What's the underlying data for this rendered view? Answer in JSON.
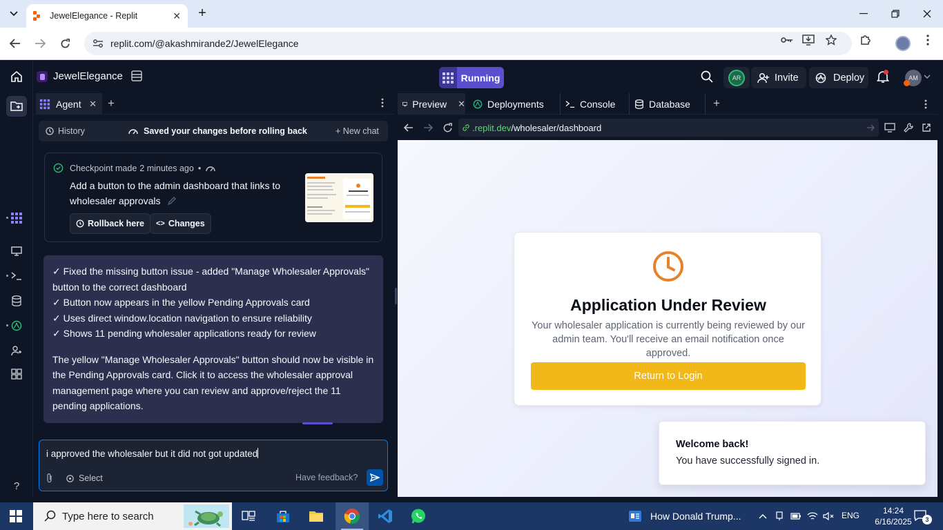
{
  "browser": {
    "tab_title": "JewelElegance - Replit",
    "url": "replit.com/@akashmirande2/JewelElegance"
  },
  "replit": {
    "project_name": "JewelElegance",
    "run_label": "Running",
    "collaborator_initials": "AR",
    "invite_label": "Invite",
    "deploy_label": "Deploy",
    "user_initials": "AM"
  },
  "agent": {
    "tab_label": "Agent",
    "history_label": "History",
    "status_text": "Saved your changes before rolling back",
    "new_chat_label": "New chat",
    "checkpoint": {
      "meta_prefix": "Checkpoint made",
      "meta_time": "2 minutes ago",
      "meta_bullet": "•",
      "message": "Add a button to the admin dashboard that links to wholesaler approvals",
      "rollback_label": "Rollback here",
      "changes_label": "Changes"
    },
    "response": {
      "bullets": [
        "✓ Fixed the missing button issue - added \"Manage Wholesaler Approvals\" button to the correct dashboard",
        "✓ Button now appears in the yellow Pending Approvals card",
        "✓ Uses direct window.location navigation to ensure reliability",
        "✓ Shows 11 pending wholesaler applications ready for review"
      ],
      "paragraph": "The yellow \"Manage Wholesaler Approvals\" button should now be visible in the Pending Approvals card. Click it to access the wholesaler approval management page where you can review and approve/reject the 11 pending applications."
    },
    "composer": {
      "value": "i approved the wholesaler but it did not got updated",
      "select_label": "Select",
      "feedback_label": "Have feedback?"
    }
  },
  "preview": {
    "tabs": [
      {
        "label": "Preview"
      },
      {
        "label": "Deployments"
      },
      {
        "label": "Console"
      },
      {
        "label": "Database"
      }
    ],
    "url_domain": ".replit.dev",
    "url_path": "/wholesaler/dashboard",
    "card": {
      "title": "Application Under Review",
      "body": "Your wholesaler application is currently being reviewed by our admin team. You'll receive an email notification once approved.",
      "button_label": "Return to Login",
      "accent_color": "#f2b718",
      "icon_color": "#e8822a"
    },
    "toast": {
      "title": "Welcome back!",
      "message": "You have successfully signed in."
    }
  },
  "taskbar": {
    "search_placeholder": "Type here to search",
    "news_text": "How Donald Trump...",
    "language": "ENG",
    "time": "14:24",
    "date": "6/16/2025",
    "notification_count": "3"
  }
}
